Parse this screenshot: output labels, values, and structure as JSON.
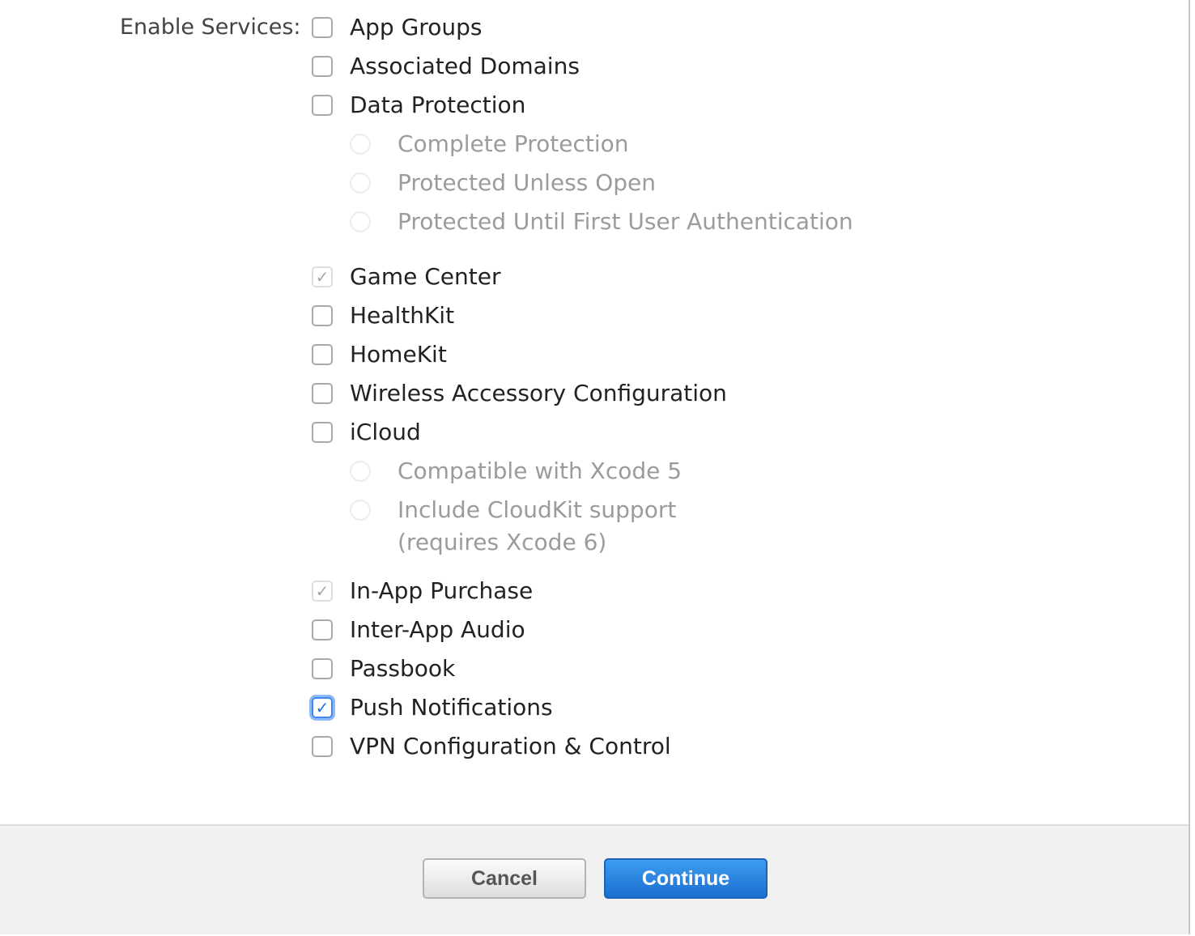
{
  "form": {
    "enable_services_label": "Enable Services:",
    "services": [
      {
        "label": "App Groups",
        "state": "unchecked"
      },
      {
        "label": "Associated Domains",
        "state": "unchecked"
      },
      {
        "label": "Data Protection",
        "state": "unchecked"
      },
      {
        "label": "Game Center",
        "state": "checked-disabled"
      },
      {
        "label": "HealthKit",
        "state": "unchecked"
      },
      {
        "label": "HomeKit",
        "state": "unchecked"
      },
      {
        "label": "Wireless Accessory Configuration",
        "state": "unchecked"
      },
      {
        "label": "iCloud",
        "state": "unchecked"
      },
      {
        "label": "In-App Purchase",
        "state": "checked-disabled"
      },
      {
        "label": "Inter-App Audio",
        "state": "unchecked"
      },
      {
        "label": "Passbook",
        "state": "unchecked"
      },
      {
        "label": "Push Notifications",
        "state": "checked"
      },
      {
        "label": "VPN Configuration & Control",
        "state": "unchecked"
      }
    ],
    "data_protection_options": [
      "Complete Protection",
      "Protected Unless Open",
      "Protected Until First User Authentication"
    ],
    "icloud_options": [
      "Compatible with Xcode 5",
      "Include CloudKit support",
      "(requires Xcode 6)"
    ],
    "checkmark_glyph": "✓"
  },
  "footer": {
    "cancel_label": "Cancel",
    "continue_label": "Continue"
  },
  "colors": {
    "accent_blue": "#1b6fd0",
    "checkbox_focus": "#3b89f5",
    "footer_bg": "#f1f1f1",
    "disabled_text": "#9b9b9b"
  }
}
